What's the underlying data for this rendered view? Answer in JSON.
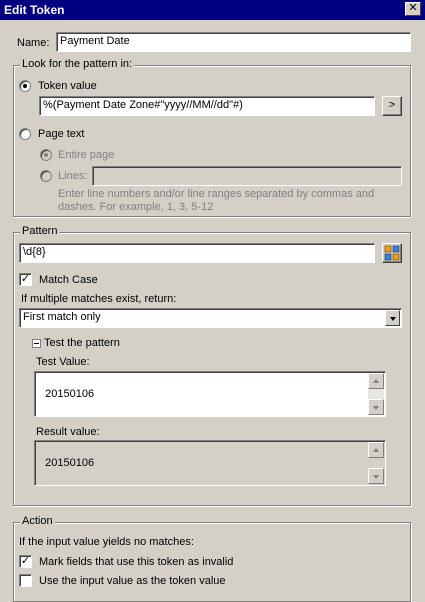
{
  "window": {
    "title": "Edit Token",
    "close_glyph": "✕"
  },
  "name_field": {
    "label": "Name:",
    "value": "Payment Date"
  },
  "look_for": {
    "legend": "Look for the pattern in:",
    "token_value_label": "Token value",
    "token_value": "%(Payment Date Zone#\"yyyy//MM//dd\"#)",
    "expand_button": ">",
    "page_text_label": "Page text",
    "entire_page_label": "Entire page",
    "lines_label": "Lines:",
    "lines_value": "",
    "help_line1": "Enter line numbers and/or line ranges separated by commas and",
    "help_line2": "dashes.  For example, 1, 3, 5-12"
  },
  "pattern": {
    "legend": "Pattern",
    "value": "\\d{8}",
    "match_case_label": "Match Case",
    "match_case_checked": true,
    "multiple_label": "If multiple matches exist, return:",
    "multiple_selected": "First match only",
    "test_header": "Test the pattern",
    "test_value_label": "Test Value:",
    "test_value": "20150106",
    "result_label": "Result value:",
    "result_value": "20150106"
  },
  "action": {
    "legend": "Action",
    "no_match_label": "If the input value yields no matches:",
    "mark_invalid_label": "Mark fields that use this token as invalid",
    "mark_invalid_checked": true,
    "use_input_label": "Use the input value as the token value",
    "use_input_checked": false
  }
}
